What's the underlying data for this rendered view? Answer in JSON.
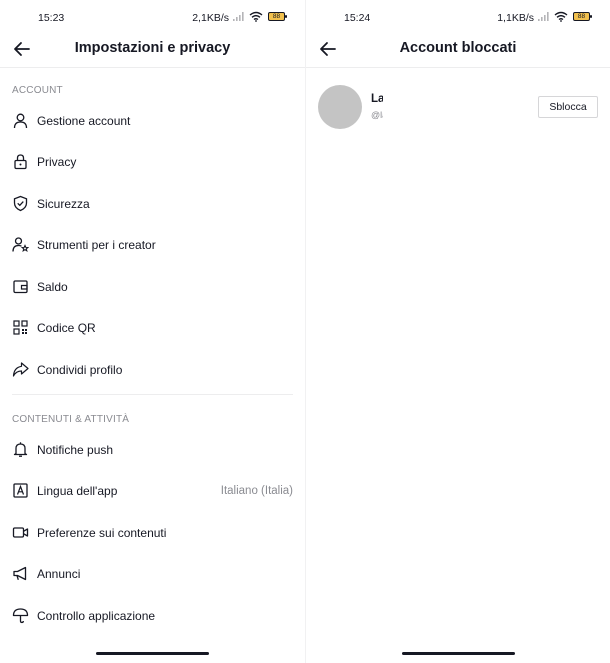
{
  "left": {
    "status": {
      "time": "15:23",
      "net": "2,1KB/s",
      "battery": "88"
    },
    "title": "Impostazioni e privacy",
    "sections": [
      {
        "title": "ACCOUNT",
        "items": [
          {
            "label": "Gestione account",
            "icon": "person-icon"
          },
          {
            "label": "Privacy",
            "icon": "lock-icon"
          },
          {
            "label": "Sicurezza",
            "icon": "shield-icon"
          },
          {
            "label": "Strumenti per i creator",
            "icon": "creator-icon"
          },
          {
            "label": "Saldo",
            "icon": "wallet-icon"
          },
          {
            "label": "Codice QR",
            "icon": "qr-code-icon"
          },
          {
            "label": "Condividi profilo",
            "icon": "share-icon"
          }
        ]
      },
      {
        "title": "CONTENUTI & ATTIVITÀ",
        "items": [
          {
            "label": "Notifiche push",
            "icon": "bell-icon"
          },
          {
            "label": "Lingua dell'app",
            "icon": "language-icon",
            "value": "Italiano (Italia)"
          },
          {
            "label": "Preferenze sui contenuti",
            "icon": "video-icon"
          },
          {
            "label": "Annunci",
            "icon": "megaphone-icon"
          },
          {
            "label": "Controllo applicazione",
            "icon": "umbrella-icon"
          }
        ]
      }
    ]
  },
  "right": {
    "status": {
      "time": "15:24",
      "net": "1,1KB/s",
      "battery": "88"
    },
    "title": "Account bloccati",
    "blocked": [
      {
        "name": "La",
        "handle": "@la",
        "button": "Sblocca"
      }
    ]
  }
}
